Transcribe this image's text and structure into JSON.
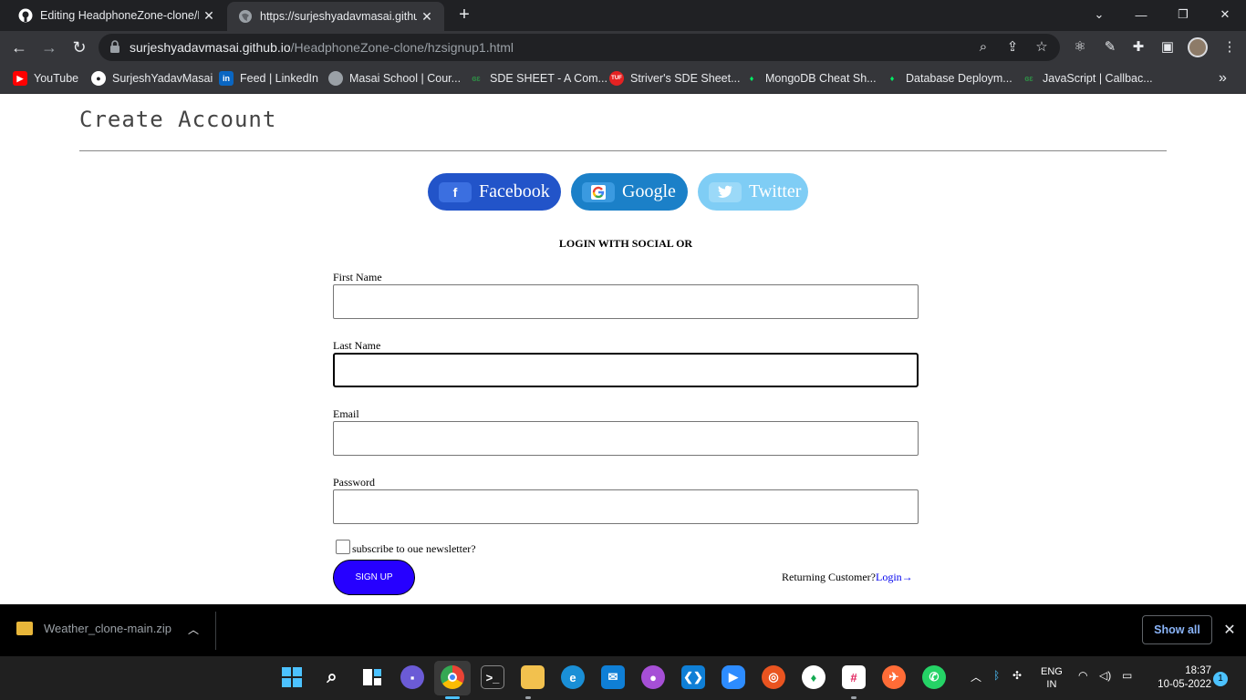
{
  "browser": {
    "tabs": [
      {
        "title": "Editing HeadphoneZone-clone/R",
        "active": false
      },
      {
        "title": "https://surjeshyadavmasai.githu",
        "active": true
      }
    ],
    "url_host": "surjeshyadavmasai.github.io",
    "url_path": "/HeadphoneZone-clone/hzsignup1.html",
    "bookmarks": [
      {
        "label": "YouTube",
        "icon": "youtube-icon"
      },
      {
        "label": "SurjeshYadavMasai",
        "icon": "github-icon"
      },
      {
        "label": "Feed | LinkedIn",
        "icon": "linkedin-icon"
      },
      {
        "label": "Masai School | Cour...",
        "icon": "globe-icon"
      },
      {
        "label": "SDE SHEET - A Com...",
        "icon": "gfg-icon"
      },
      {
        "label": "Striver's SDE Sheet...",
        "icon": "tuf-icon"
      },
      {
        "label": "MongoDB Cheat Sh...",
        "icon": "mongodb-icon"
      },
      {
        "label": "Database Deploym...",
        "icon": "mongodb-icon"
      },
      {
        "label": "JavaScript | Callbac...",
        "icon": "gfg-icon"
      }
    ],
    "bookmarks_overflow": "»"
  },
  "page": {
    "heading": "Create Account",
    "social_buttons": [
      {
        "label": "Facebook",
        "glyph": "f"
      },
      {
        "label": "Google",
        "glyph": "G"
      },
      {
        "label": "Twitter",
        "glyph": "✔"
      }
    ],
    "login_with_social": "LOGIN WITH SOCIAL OR",
    "fields": [
      {
        "label": "First Name",
        "value": ""
      },
      {
        "label": "Last Name",
        "value": ""
      },
      {
        "label": "Email",
        "value": ""
      },
      {
        "label": "Password",
        "value": ""
      }
    ],
    "newsletter_label": "subscribe to oue newsletter?",
    "signup_label": "SIGN UP",
    "returning_text": "Returning Customer?",
    "login_link": "Login→"
  },
  "downloads": {
    "file_name": "Weather_clone-main.zip",
    "show_all": "Show all"
  },
  "taskbar": {
    "language": "ENG",
    "region": "IN",
    "time": "18:37",
    "date": "10-05-2022",
    "notification_count": "1"
  },
  "colors": {
    "signup_button": "#2600ff",
    "facebook": "#2254c9",
    "google": "#1b80c8",
    "twitter": "#7fcdf5",
    "chrome_dark": "#35363a"
  }
}
